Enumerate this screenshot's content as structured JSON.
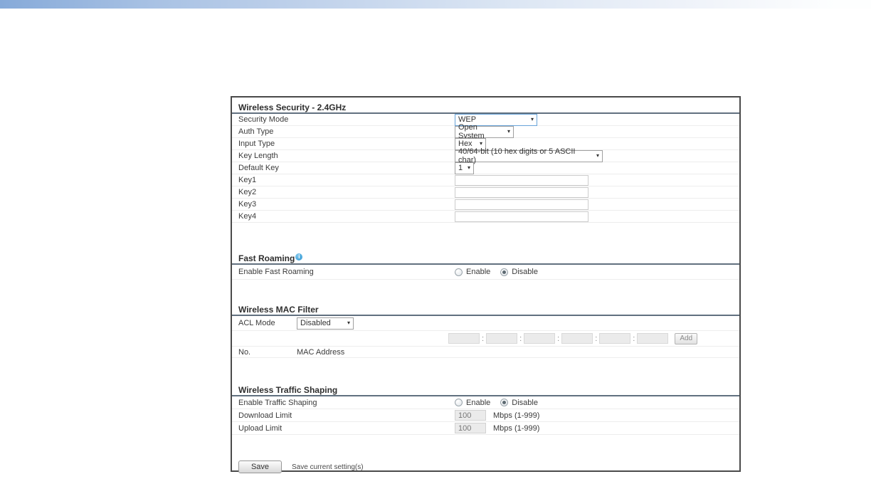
{
  "icons": {
    "select_arrow": "▾",
    "info": "i",
    "mac_separator": ":"
  },
  "colors": {
    "accent_select_border": "#67a3d9",
    "heading_rule": "#61707f",
    "info_icon_blue": "#2f97d2",
    "topbar_gradient_left": "#86aad9",
    "topbar_gradient_right": "#fdfefe"
  },
  "security": {
    "title": "Wireless Security - 2.4GHz",
    "security_mode": {
      "label": "Security Mode",
      "value": "WEP"
    },
    "auth_type": {
      "label": "Auth Type",
      "value": "Open System"
    },
    "input_type": {
      "label": "Input Type",
      "value": "Hex"
    },
    "key_length": {
      "label": "Key Length",
      "value": "40/64-bit (10 hex digits or 5 ASCII char)"
    },
    "default_key": {
      "label": "Default Key",
      "value": "1"
    },
    "keys": [
      {
        "label": "Key1",
        "value": ""
      },
      {
        "label": "Key2",
        "value": ""
      },
      {
        "label": "Key3",
        "value": ""
      },
      {
        "label": "Key4",
        "value": ""
      }
    ]
  },
  "fast_roaming": {
    "title": "Fast Roaming",
    "enable_label": "Enable Fast Roaming",
    "options": [
      "Enable",
      "Disable"
    ],
    "selected": "Disable"
  },
  "mac_filter": {
    "title": "Wireless MAC Filter",
    "acl_label": "ACL Mode",
    "acl_value": "Disabled",
    "mac_inputs": [
      "",
      "",
      "",
      "",
      "",
      ""
    ],
    "add_label": "Add",
    "col_no": "No.",
    "col_mac": "MAC Address"
  },
  "traffic_shaping": {
    "title": "Wireless Traffic Shaping",
    "enable_label": "Enable Traffic Shaping",
    "options": [
      "Enable",
      "Disable"
    ],
    "selected": "Disable",
    "download_label": "Download Limit",
    "download_value": "100",
    "download_unit": "Mbps (1-999)",
    "upload_label": "Upload Limit",
    "upload_value": "100",
    "upload_unit": "Mbps (1-999)"
  },
  "footer": {
    "save_label": "Save",
    "save_note": "Save current setting(s)"
  }
}
